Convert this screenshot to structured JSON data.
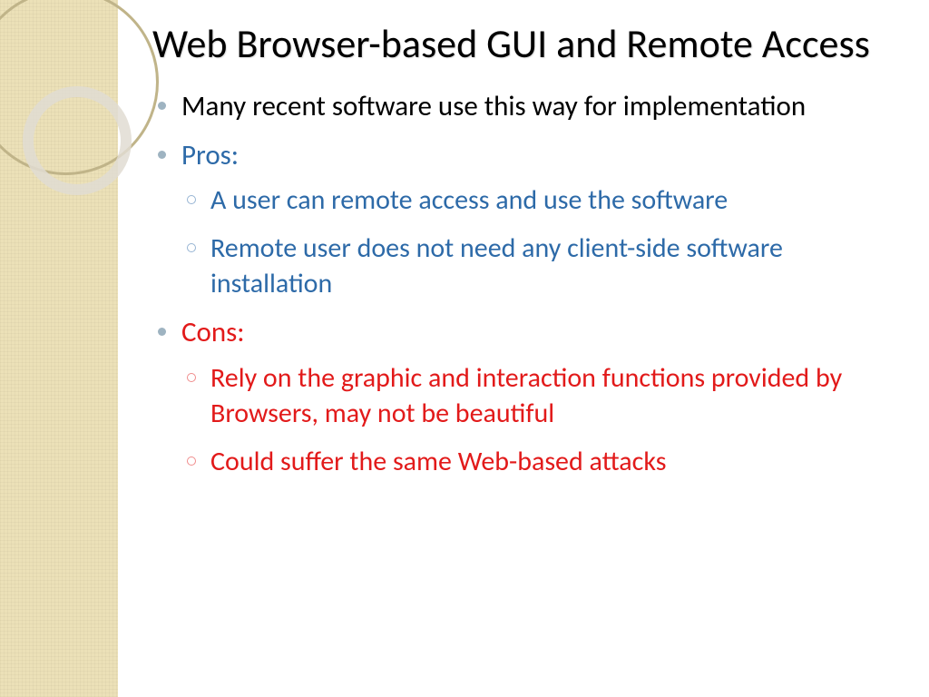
{
  "title": "Web Browser-based GUI and Remote Access",
  "bullets": {
    "intro": "Many recent software use this way for implementation",
    "pros_label": "Pros:",
    "pros": [
      "A user can remote access and use the software",
      "Remote user does not need any client-side software installation"
    ],
    "cons_label": "Cons:",
    "cons": [
      "Rely on the graphic and interaction functions provided by Browsers, may not be beautiful",
      "Could suffer the same Web-based attacks"
    ]
  },
  "colors": {
    "sidebar": "#ece1b8",
    "blue": "#2d6aa8",
    "red": "#e21a1a"
  }
}
